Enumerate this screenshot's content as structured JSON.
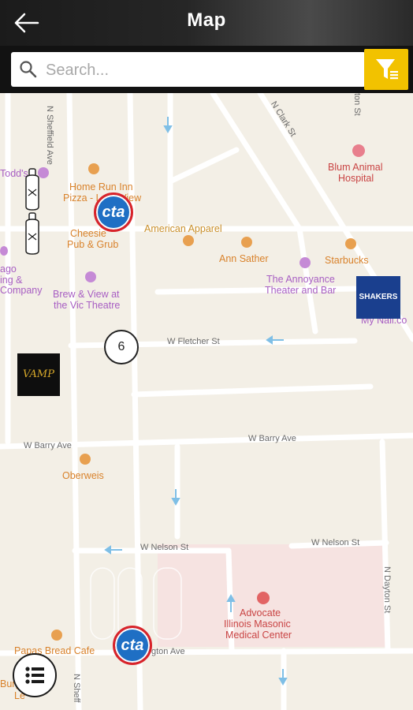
{
  "header": {
    "title": "Map"
  },
  "search": {
    "placeholder": "Search..."
  },
  "map": {
    "streets": {
      "n_sheffield_ave": "N Sheffield Ave",
      "n_sheffield_ave_bottom": "N Sheff",
      "n_clark_st": "N Clark St",
      "w_fletcher_st": "W Fletcher St",
      "w_barry_ave": "W Barry Ave",
      "w_barry_ave_right": "W Barry Ave",
      "w_nelson_st_left": "W Nelson St",
      "w_nelson_st_right": "W Nelson St",
      "wellington_ave": "gton Ave",
      "american_apparel": "American Apparel",
      "n_dayton_st": "N Dayton St",
      "top_right_street": "ton St"
    },
    "places": {
      "todds": "Todd's",
      "home_run_inn": "Home Run Inn",
      "home_run_inn_2": "Pizza - Lake View",
      "cheesie_1": "Cheesie",
      "cheesie_2": "Pub & Grub",
      "blum_1": "Blum Animal",
      "blum_2": "Hospital",
      "ann_sather": "Ann Sather",
      "starbucks": "Starbucks",
      "annoyance_1": "The Annoyance",
      "annoyance_2": "Theater and Bar",
      "my_nail": "My Nail.co",
      "chicago_1": "ago",
      "chicago_2": "ing &",
      "chicago_3": "Company",
      "brew_1": "Brew & View at",
      "brew_2": "the Vic Theatre",
      "oberweis": "Oberweis",
      "advocate_1": "Advocate",
      "advocate_2": "Illinois Masonic",
      "advocate_3": "Medical Center",
      "papas": "Papas Bread Cafe",
      "burg": "Burg",
      "le": "Le"
    },
    "cluster_count": "6",
    "cta_label": "cta",
    "vamp_label": "VAMP",
    "shakers_label": "SHAKERS"
  }
}
